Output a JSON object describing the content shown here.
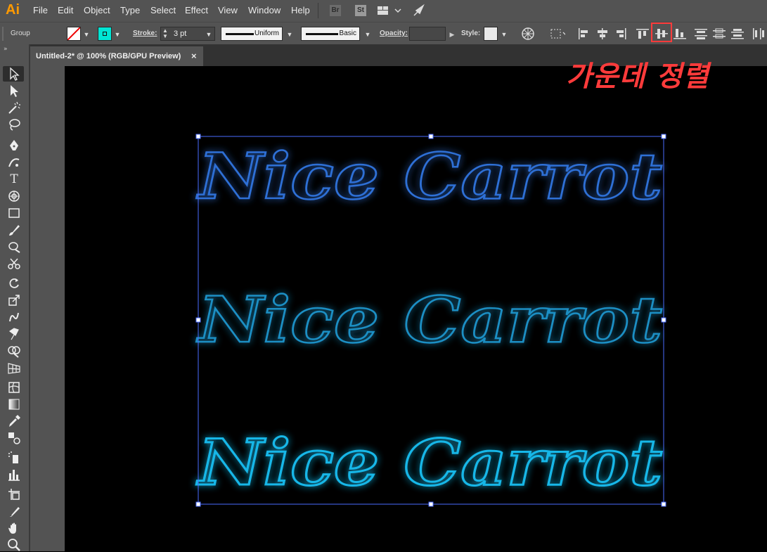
{
  "app": {
    "logo": "Ai"
  },
  "menu": [
    "File",
    "Edit",
    "Object",
    "Type",
    "Select",
    "Effect",
    "View",
    "Window",
    "Help"
  ],
  "app_buttons": {
    "bridge": "Br",
    "stock": "St"
  },
  "control": {
    "selection_type": "Group",
    "stroke_label": "Stroke:",
    "stroke_weight": "3 pt",
    "profile": "Uniform",
    "brush": "Basic",
    "opacity_label": "Opacity:",
    "opacity_value": "",
    "style_label": "Style:"
  },
  "document": {
    "tab_title": "Untitled-2* @ 100% (RGB/GPU Preview)",
    "close": "×"
  },
  "artwork": {
    "text_lines": [
      "Nice Carrot",
      "Nice Carrot",
      "Nice Carrot"
    ]
  },
  "annotation": {
    "text": "가운데 정렬"
  },
  "colors": {
    "accent_fill": "#00e5d4",
    "highlight": "#ff3b3b",
    "selection": "#4a6cff",
    "glow_top": "#2f6fd6",
    "glow_mid": "#1a8fc4",
    "glow_bottom": "#19b7e8"
  }
}
